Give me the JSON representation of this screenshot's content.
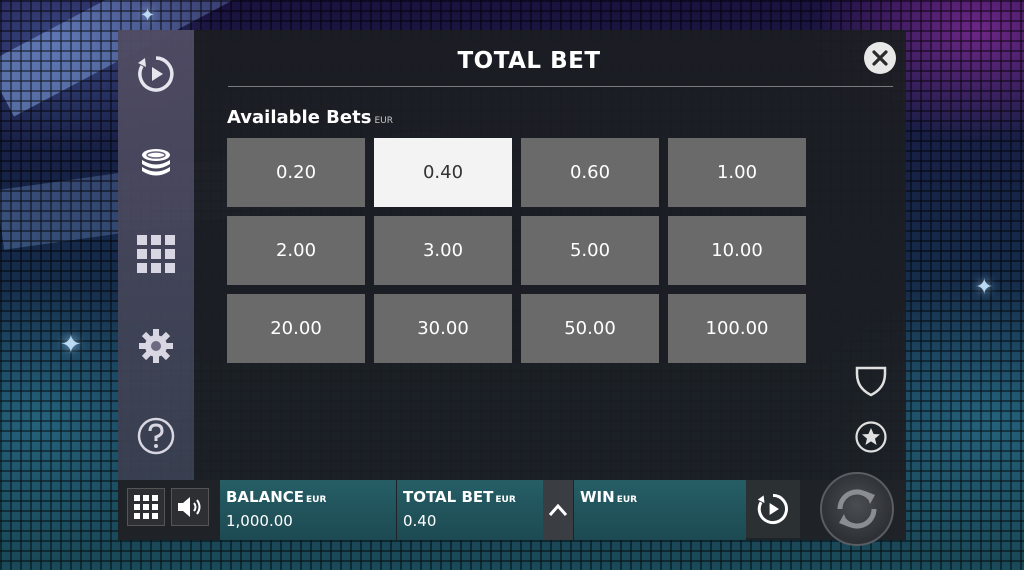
{
  "dialog": {
    "title": "TOTAL BET",
    "bets_label": "Available Bets",
    "bets_currency": "EUR",
    "selected_bet": "0.40",
    "bets": [
      "0.20",
      "0.40",
      "0.60",
      "1.00",
      "2.00",
      "3.00",
      "5.00",
      "10.00",
      "20.00",
      "30.00",
      "50.00",
      "100.00"
    ]
  },
  "sidebar": {
    "items": [
      {
        "icon": "autoplay-icon"
      },
      {
        "icon": "coins-icon"
      },
      {
        "icon": "paytable-grid-icon"
      },
      {
        "icon": "gear-icon"
      },
      {
        "icon": "help-icon"
      }
    ]
  },
  "bottom_bar": {
    "balance_label": "BALANCE",
    "balance_currency": "EUR",
    "balance_value": "1,000.00",
    "total_bet_label": "TOTAL BET",
    "total_bet_currency": "EUR",
    "total_bet_value": "0.40",
    "win_label": "WIN",
    "win_currency": "EUR"
  },
  "colors": {
    "panel": "#1c1e22",
    "bet_button": "#6a6a6a",
    "bet_selected": "#f3f3f3",
    "info_panel": "#265e66"
  }
}
